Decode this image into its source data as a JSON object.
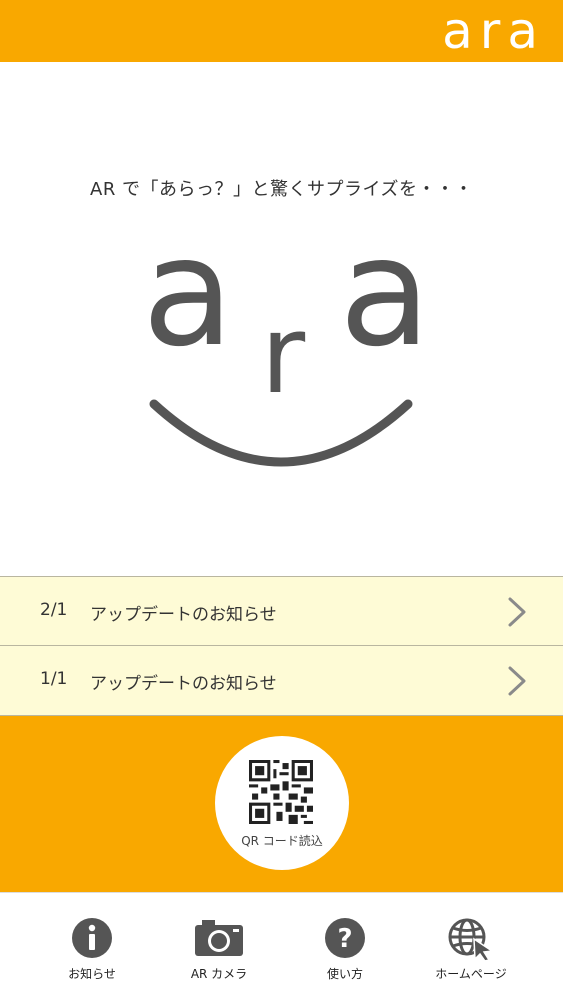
{
  "header": {
    "logo_text": "ara"
  },
  "hero": {
    "tagline": "AR で「あらっ？」と驚くサプライズを・・・",
    "logo_letters": [
      "a",
      "r",
      "a"
    ]
  },
  "news": [
    {
      "date": "2/1",
      "title": "アップデートのお知らせ"
    },
    {
      "date": "1/1",
      "title": "アップデートのお知らせ"
    }
  ],
  "qr": {
    "label": "QR コード読込"
  },
  "tabs": [
    {
      "label": "お知らせ",
      "icon": "info-icon"
    },
    {
      "label": "AR カメラ",
      "icon": "camera-icon"
    },
    {
      "label": "使い方",
      "icon": "help-icon"
    },
    {
      "label": "ホームページ",
      "icon": "globe-cursor-icon"
    }
  ],
  "colors": {
    "brand_orange": "#f9a800",
    "news_bg": "#fefbd6",
    "icon_gray": "#555555"
  }
}
